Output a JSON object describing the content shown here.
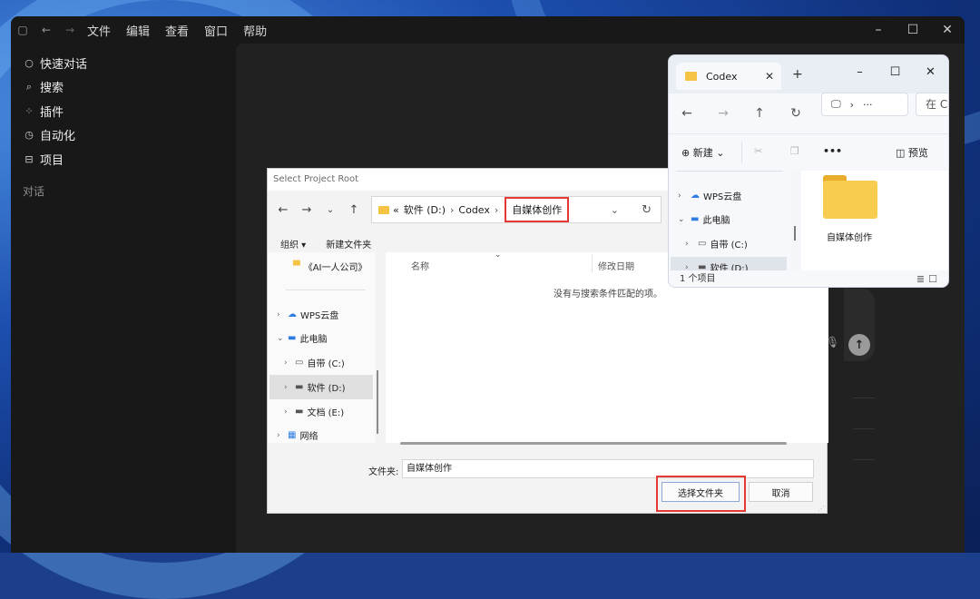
{
  "app": {
    "menu": [
      "文件",
      "编辑",
      "查看",
      "窗口",
      "帮助"
    ],
    "sidebar": [
      {
        "label": "快速对话",
        "icon": "chat-icon"
      },
      {
        "label": "搜索",
        "icon": "search-icon"
      },
      {
        "label": "插件",
        "icon": "plugins-icon"
      },
      {
        "label": "自动化",
        "icon": "clock-icon"
      },
      {
        "label": "项目",
        "icon": "project-icon"
      }
    ],
    "section_label": "对话"
  },
  "dialog": {
    "title": "Select Project Root",
    "address": {
      "prefix": "«",
      "seg1": "软件 (D:)",
      "seg2": "Codex",
      "current": "自媒体创作"
    },
    "toolbar": {
      "organize": "组织 ▾",
      "new_folder": "新建文件夹"
    },
    "tree": {
      "quick_item": "《AI一人公司》",
      "wps": "WPS云盘",
      "this_pc": "此电脑",
      "drive_c": "自带 (C:)",
      "drive_d": "软件 (D:)",
      "drive_e": "文档 (E:)",
      "network": "网络"
    },
    "columns": {
      "name": "名称",
      "modified": "修改日期"
    },
    "empty_message": "没有与搜索条件匹配的项。",
    "folder_label": "文件夹:",
    "folder_value": "自媒体创作",
    "select_button": "选择文件夹",
    "cancel_button": "取消"
  },
  "explorer": {
    "tab_title": "Codex",
    "address_more": "···",
    "search_placeholder": "在 Co",
    "new_label": "新建",
    "more": "•••",
    "preview": "预览",
    "tree": {
      "wps": "WPS云盘",
      "this_pc": "此电脑",
      "drive_c": "自带 (C:)",
      "drive_d": "软件 (D:)"
    },
    "folder_item": "自媒体创作",
    "status": "1 个项目"
  },
  "colors": {
    "highlight": "#e53935",
    "folder": "#f8cc4f",
    "app_bg": "#181818"
  }
}
